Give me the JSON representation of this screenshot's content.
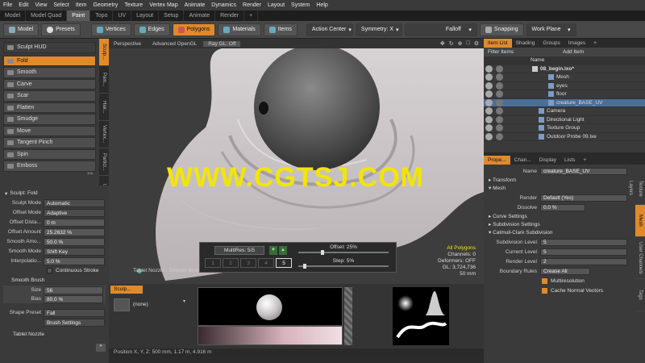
{
  "menu": [
    "File",
    "Edit",
    "View",
    "Select",
    "Item",
    "Geometry",
    "Texture",
    "Vertex Map",
    "Animate",
    "Dynamics",
    "Render",
    "Layout",
    "System",
    "Help"
  ],
  "layout_tabs": [
    {
      "label": "Model",
      "active": false
    },
    {
      "label": "Model Quad",
      "active": false
    },
    {
      "label": "Paint",
      "active": true
    },
    {
      "label": "Topo",
      "active": false
    },
    {
      "label": "UV",
      "active": false
    },
    {
      "label": "Layout",
      "active": false
    },
    {
      "label": "Setup",
      "active": false
    },
    {
      "label": "Animate",
      "active": false
    },
    {
      "label": "Render",
      "active": false
    },
    {
      "label": "+",
      "active": false
    }
  ],
  "toolbar": {
    "model": "Model",
    "presets": "Presets",
    "vertices": "Vertices",
    "edges": "Edges",
    "polygons": "Polygons",
    "materials": "Materials",
    "items": "Items",
    "action_center": "Action Center",
    "symmetry": "Symmetry: X",
    "falloff": "Falloff",
    "snapping": "Snapping",
    "work_plane": "Work Plane"
  },
  "sculpt": {
    "hud_label": "Sculpt HUD",
    "tools": [
      {
        "label": "Fold",
        "active": true
      },
      {
        "label": "Smooth",
        "active": false
      },
      {
        "label": "Carve",
        "active": false
      },
      {
        "label": "Scar",
        "active": false
      },
      {
        "label": "Flatten",
        "active": false
      },
      {
        "label": "Smudge",
        "active": false
      },
      {
        "label": "Move",
        "active": false
      },
      {
        "label": "Tangent Pinch",
        "active": false
      },
      {
        "label": "Spin",
        "active": false
      },
      {
        "label": "Emboss",
        "active": false
      }
    ],
    "vtabs": [
      {
        "label": "Sculp...",
        "active": true
      },
      {
        "label": "Pain...",
        "active": false
      },
      {
        "label": "Hair...",
        "active": false
      },
      {
        "label": "Vertex...",
        "active": false
      },
      {
        "label": "Particl...",
        "active": false
      },
      {
        "label": "Util...",
        "active": false
      }
    ],
    "vtabs_more": ">>"
  },
  "tool_props": {
    "header": "Sculpt: Fold",
    "rows": [
      {
        "label": "Sculpt Mode",
        "value": "Automatic"
      },
      {
        "label": "Offset Mode",
        "value": "Adaptive"
      },
      {
        "label": "Offset Dista...",
        "value": "0 m"
      },
      {
        "label": "Offset Amount",
        "value": "25.2632 %"
      },
      {
        "label": "Smooth Amo...",
        "value": "50.0 %"
      },
      {
        "label": "Smooth Mode",
        "value": "Shift Key"
      },
      {
        "label": "Interpolatio...",
        "value": "5.0 %"
      }
    ],
    "continuous_stroke": "Continuous Stroke",
    "smooth_brush": "Smooth Brush",
    "size_label": "Size",
    "size_value": "56",
    "bias_label": "Bias",
    "bias_value": "80.0 %",
    "shape_preset_label": "Shape Preset",
    "shape_preset_value": "Fall",
    "brush_settings": "Brush Settings",
    "tablet_nozzle": "Tablet Nozzle"
  },
  "viewport": {
    "tabs": [
      "Perspective",
      "Advanced OpenGL",
      "Ray GL: Off"
    ],
    "watermark": "WWW.CGTSJ.COM",
    "info": {
      "selection": "All Polygons",
      "channels": "Channels: 0",
      "deformers": "Deformers: OFF",
      "gl": "GL: 3,724,736",
      "size": "50 mm"
    },
    "nozzle": "Tablet Nozzle : Smooth Brush : sculpt fold",
    "multires": "MultiRes: 5/5",
    "offset_label": "Offset:",
    "offset_value": "25%",
    "step_label": "Step:",
    "step_value": "5%",
    "levels": [
      "1",
      "2",
      "3",
      "4",
      "5"
    ],
    "active_level": "5"
  },
  "bottom": {
    "tab": "Sculp...",
    "brush_none": "(none)",
    "status": "Position X, Y, Z:   500 mm,  1.17 m,  4.916 m"
  },
  "items_panel": {
    "tabs": [
      "Item List",
      "Shading",
      "Groups",
      "Images",
      "+"
    ],
    "filter": "Filter Items",
    "add_item": "Add Item",
    "col_name": "Name",
    "items": [
      {
        "label": "08_begin.lxo*",
        "selected": false
      },
      {
        "label": "Mesh",
        "selected": false
      },
      {
        "label": "eyes",
        "selected": false
      },
      {
        "label": "floor",
        "selected": false
      },
      {
        "label": "creature_BASE_UV",
        "selected": true
      },
      {
        "label": "Camera",
        "selected": false
      },
      {
        "label": "Directional Light",
        "selected": false
      },
      {
        "label": "Texture Group",
        "selected": false
      },
      {
        "label": "Outdoor Probe 09.lxe",
        "selected": false
      }
    ]
  },
  "properties_panel": {
    "tabs": [
      "Prope...",
      "Chan...",
      "Display",
      "Lists",
      "+"
    ],
    "name_label": "Name",
    "name_value": "creature_BASE_UV",
    "sections": [
      "Transform",
      "Mesh"
    ],
    "render_label": "Render",
    "render_value": "Default (Yes)",
    "dissolve_label": "Dissolve",
    "dissolve_value": "0.0 %",
    "curve_settings": "Curve Settings",
    "subdivision_settings": "Subdivision Settings",
    "catmull": "Catmull-Clark Subdivision",
    "sub_level_label": "Subdivision Level",
    "sub_level_value": "5",
    "cur_level_label": "Current Level",
    "cur_level_value": "5",
    "render_level_label": "Render Level",
    "render_level_value": "2",
    "boundary_label": "Boundary Rules",
    "boundary_value": "Crease All",
    "multires": "Multiresolution",
    "cache": "Cache Normal Vectors",
    "side_tabs": [
      "Texture Layers",
      "Mesh",
      "User Channels",
      "Tags"
    ]
  },
  "colors": {
    "accent": "#e08a2c",
    "selection": "#4b6d9a",
    "watermark": "#f2e600"
  }
}
